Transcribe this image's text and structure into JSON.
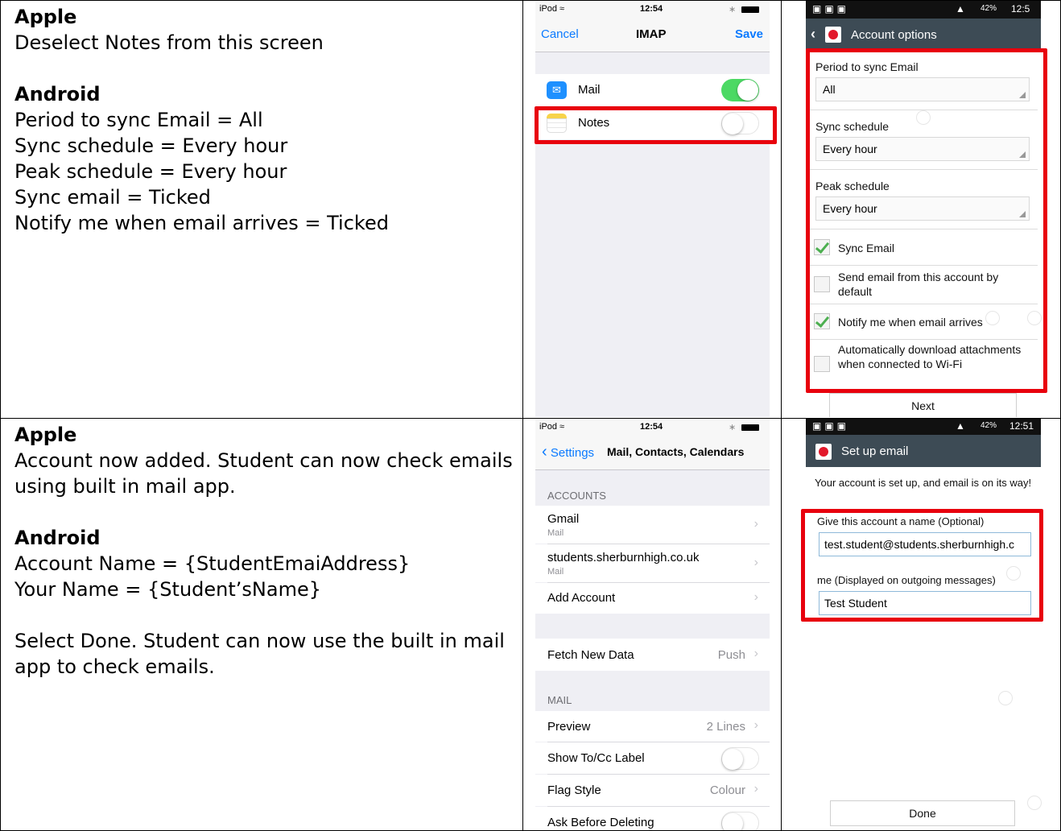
{
  "rows": [
    {
      "apple_heading": "Apple",
      "apple_lines": [
        "Deselect Notes from this screen"
      ],
      "android_heading": "Android",
      "android_lines": [
        "Period to sync Email = All",
        "Sync schedule = Every hour",
        "Peak schedule = Every hour",
        "Sync email = Ticked",
        "Notify me when email arrives = Ticked"
      ]
    },
    {
      "apple_heading": "Apple",
      "apple_lines": [
        "Account now added. Student can now check emails",
        "using built in mail app."
      ],
      "android_heading": "Android",
      "android_lines": [
        "Account Name = {StudentEmaiAddress}",
        "Your Name = {Student’sName}",
        "",
        "Select Done. Student can now use the built in mail",
        "app to check emails."
      ]
    }
  ],
  "ios_imap": {
    "carrier": "iPod",
    "time": "12:54",
    "cancel": "Cancel",
    "title": "IMAP",
    "save": "Save",
    "items": [
      {
        "label": "Mail",
        "on": true
      },
      {
        "label": "Notes",
        "on": false
      }
    ]
  },
  "ios_settings": {
    "carrier": "iPod",
    "time": "12:54",
    "back": "Settings",
    "title": "Mail, Contacts, Calendars",
    "accounts_header": "ACCOUNTS",
    "accounts": [
      {
        "label": "Gmail",
        "sub": "Mail"
      },
      {
        "label": "students.sherburnhigh.co.uk",
        "sub": "Mail"
      },
      {
        "label": "Add Account",
        "sub": ""
      }
    ],
    "fetch_label": "Fetch New Data",
    "fetch_value": "Push",
    "mail_header": "MAIL",
    "preview_label": "Preview",
    "preview_value": "2 Lines",
    "show_tocc": "Show To/Cc Label",
    "flag_label": "Flag Style",
    "flag_value": "Colour",
    "ask_delete": "Ask Before Deleting"
  },
  "android_options": {
    "status_time": "12:5",
    "battery": "42%",
    "title": "Account options",
    "period_label": "Period to sync Email",
    "period_value": "All",
    "sync_label": "Sync schedule",
    "sync_value": "Every hour",
    "peak_label": "Peak schedule",
    "peak_value": "Every hour",
    "checks": [
      {
        "label": "Sync Email",
        "checked": true
      },
      {
        "label": "Send email from this account by default",
        "checked": false
      },
      {
        "label": "Notify me when email arrives",
        "checked": true
      },
      {
        "label": "Automatically download attachments when connected to Wi-Fi",
        "checked": false
      }
    ],
    "next": "Next"
  },
  "android_setup": {
    "status_time": "12:51",
    "battery": "42%",
    "title": "Set up email",
    "intro": "Your account is set up, and email is on its way!",
    "name_label": "Give this account a name (Optional)",
    "name_value": "test.student@students.sherburnhigh.c",
    "your_label": "me (Displayed on outgoing messages)",
    "your_value": "Test Student",
    "done": "Done"
  },
  "colors": {
    "ios_blue": "#0a7aff",
    "toggle_on": "#4cd964",
    "highlight": "#e8000d",
    "android_bar": "#3d4b55"
  }
}
